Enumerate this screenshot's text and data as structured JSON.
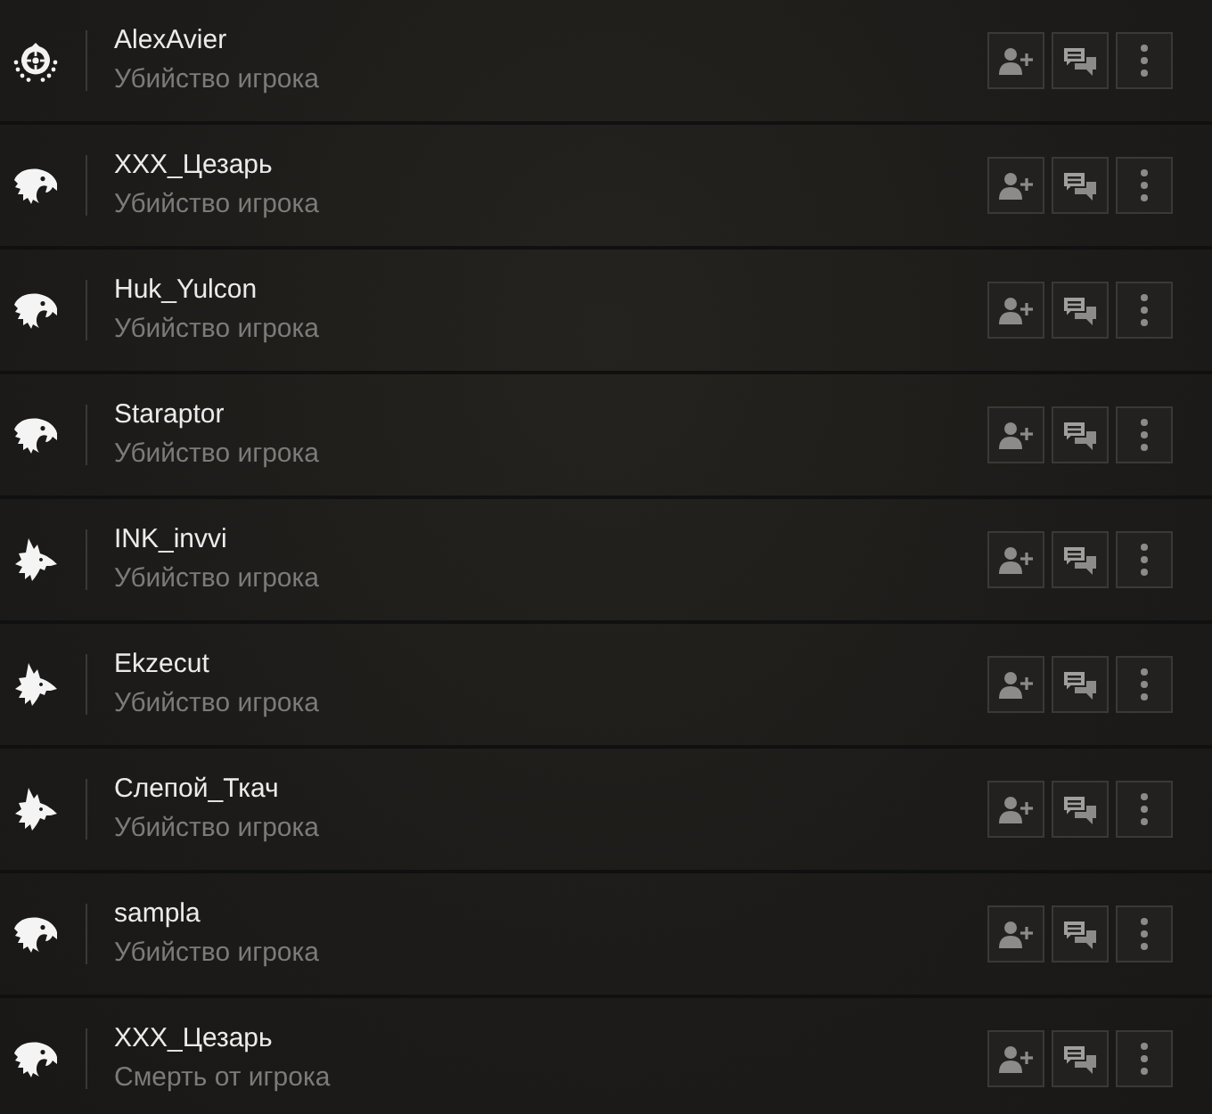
{
  "rows": [
    {
      "kind": "crosshair",
      "name": "AlexAvier",
      "event": "Убийство игрока"
    },
    {
      "kind": "eagle",
      "name": "XXX_Цезарь",
      "event": "Убийство игрока"
    },
    {
      "kind": "eagle",
      "name": "Huk_Yulcon",
      "event": "Убийство игрока"
    },
    {
      "kind": "eagle",
      "name": "Staraptor",
      "event": "Убийство игрока"
    },
    {
      "kind": "wolf",
      "name": "INK_invvi",
      "event": "Убийство игрока"
    },
    {
      "kind": "wolf",
      "name": "Ekzecut",
      "event": "Убийство игрока"
    },
    {
      "kind": "wolf",
      "name": "Слепой_Ткач",
      "event": "Убийство игрока"
    },
    {
      "kind": "eagle",
      "name": "sampla",
      "event": "Убийство игрока"
    },
    {
      "kind": "eagle",
      "name": "XXX_Цезарь",
      "event": "Смерть от игрока"
    }
  ]
}
